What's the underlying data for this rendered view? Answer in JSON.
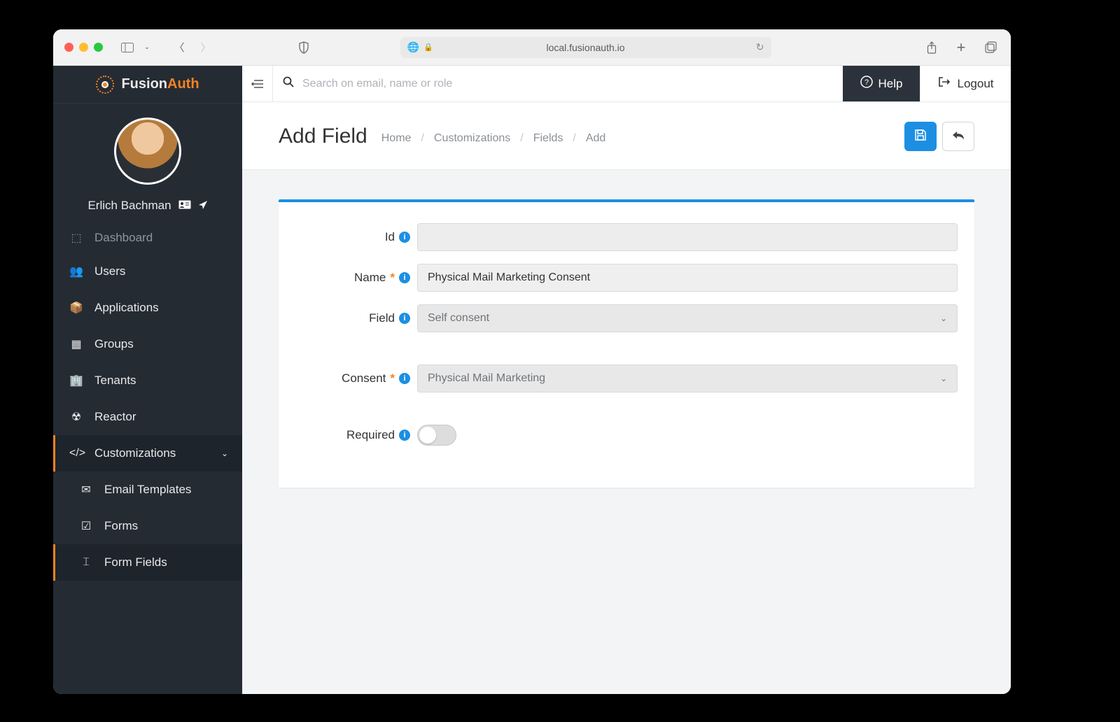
{
  "browser": {
    "url": "local.fusionauth.io"
  },
  "brand": {
    "name_a": "Fusion",
    "name_b": "Auth"
  },
  "user": {
    "name": "Erlich Bachman"
  },
  "nav": {
    "truncated": "Dashboard",
    "items": [
      {
        "icon": "👥",
        "label": "Users"
      },
      {
        "icon": "📦",
        "label": "Applications"
      },
      {
        "icon": "▦",
        "label": "Groups"
      },
      {
        "icon": "🏢",
        "label": "Tenants"
      },
      {
        "icon": "☢",
        "label": "Reactor"
      }
    ],
    "customizations": {
      "label": "Customizations"
    },
    "sub": [
      {
        "icon": "✉",
        "label": "Email Templates"
      },
      {
        "icon": "☑",
        "label": "Forms"
      },
      {
        "icon": "⌶",
        "label": "Form Fields"
      }
    ]
  },
  "topbar": {
    "search_placeholder": "Search on email, name or role",
    "help": "Help",
    "logout": "Logout"
  },
  "page": {
    "title": "Add Field",
    "crumbs": [
      "Home",
      "Customizations",
      "Fields",
      "Add"
    ]
  },
  "form": {
    "id": {
      "label": "Id",
      "value": ""
    },
    "name": {
      "label": "Name",
      "value": "Physical Mail Marketing Consent"
    },
    "field": {
      "label": "Field",
      "value": "Self consent"
    },
    "consent": {
      "label": "Consent",
      "value": "Physical Mail Marketing"
    },
    "required": {
      "label": "Required",
      "value": false
    }
  }
}
